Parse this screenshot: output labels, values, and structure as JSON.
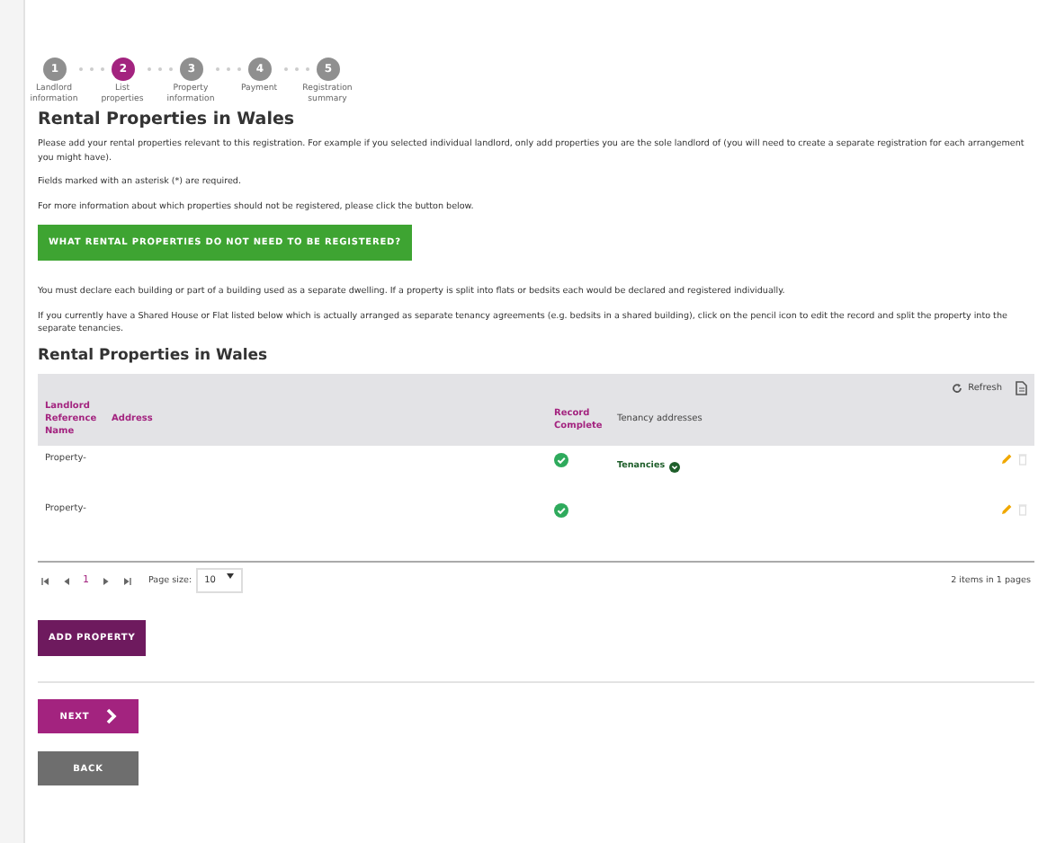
{
  "steps": [
    {
      "number": "1",
      "label": "Landlord information",
      "selected": false
    },
    {
      "number": "2",
      "label": "List properties",
      "selected": true
    },
    {
      "number": "3",
      "label": "Property information",
      "selected": false
    },
    {
      "number": "4",
      "label": "Payment",
      "selected": false
    },
    {
      "number": "5",
      "label": "Registration summary",
      "selected": false
    }
  ],
  "heading": "Rental Properties in Wales",
  "intro": [
    "Please add your rental properties relevant to this registration. For example if you selected individual landlord, only add properties you are the sole landlord of (you will need to create a separate registration for each arrangement you might have).",
    "Fields marked with an asterisk (*) are required.",
    "For more information about which properties should not be registered, please click the button below."
  ],
  "info_button": "WHAT RENTAL PROPERTIES DO NOT NEED TO BE REGISTERED?",
  "notes": [
    "You must declare each building or part of a building used as a separate dwelling. If a property is split into flats or bedsits each would be declared and registered individually.",
    "If you currently have a Shared House or Flat listed below which is actually arranged as separate tenancy agreements (e.g. bedsits in a shared building), click on the pencil icon to edit the record and split the property into the separate tenancies."
  ],
  "table": {
    "title": "Rental Properties in Wales",
    "refresh": "Refresh",
    "columns": [
      {
        "label": "Landlord Reference Name",
        "sortable": true
      },
      {
        "label": "Address",
        "sortable": true
      },
      {
        "label": "Record Complete",
        "sortable": true
      },
      {
        "label": "Tenancy addresses",
        "sortable": false
      }
    ],
    "rows": [
      {
        "reference": "Property-",
        "complete": true,
        "tenancies": "Tenancies"
      },
      {
        "reference": "Property-",
        "complete": true
      }
    ],
    "pager": {
      "current_page": "1",
      "page_size_label": "Page size:",
      "page_size": "10",
      "summary": "2 items in 1 pages"
    }
  },
  "add_button": "ADD PROPERTY",
  "next_button": "NEXT",
  "back_button": "BACK"
}
